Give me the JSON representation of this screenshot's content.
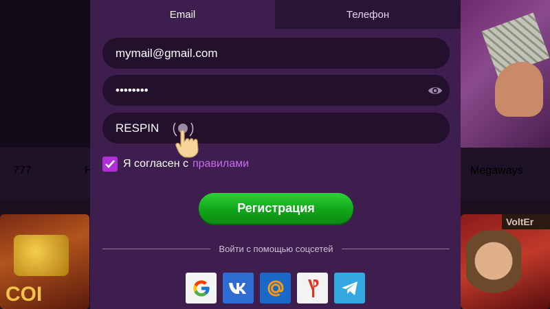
{
  "background": {
    "nav_items": [
      "777",
      "Megaways"
    ],
    "game_left_title": "COI",
    "game_right_badge": "VoltEr"
  },
  "tabs": [
    {
      "label": "Email",
      "active": true
    },
    {
      "label": "Телефон",
      "active": false
    }
  ],
  "form": {
    "email_value": "mymail@gmail.com",
    "password_value": "••••••••",
    "promo_value": "RESPIN"
  },
  "agreement": {
    "checked": true,
    "text": "Я согласен с",
    "link": "правилами"
  },
  "register_button": "Регистрация",
  "social_divider": "Войти с помощью соцсетей",
  "social_buttons": [
    "google-icon",
    "vk-icon",
    "mail-ru-icon",
    "yandex-icon",
    "telegram-icon"
  ],
  "colors": {
    "modal_bg": "#3e1e4e",
    "field_bg": "#22102d",
    "accent": "#b12fd6",
    "register_green": "#1fbf2a"
  }
}
